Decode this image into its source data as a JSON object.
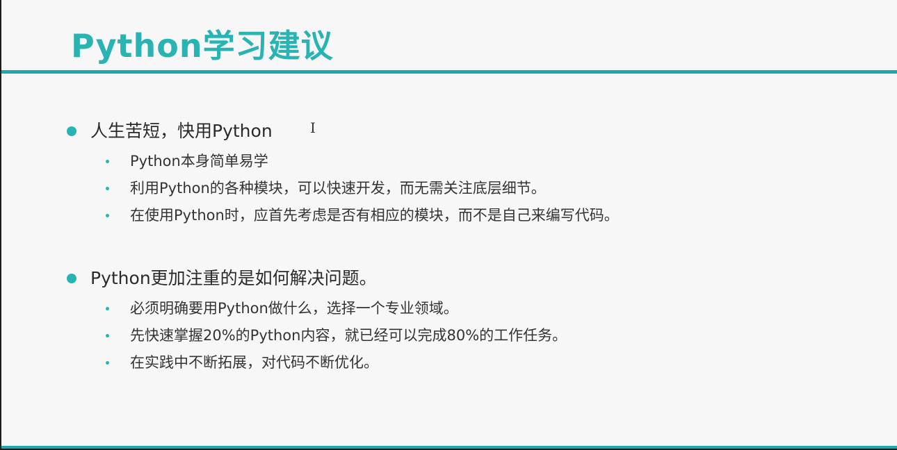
{
  "slide": {
    "title": "Python学习建议",
    "accent_color": "#2ab3b3",
    "rule_color": "#1fa8ac",
    "sections": [
      {
        "heading": "人生苦短，快用Python",
        "items": [
          "Python本身简单易学",
          "利用Python的各种模块，可以快速开发，而无需关注底层细节。",
          "在使用Python时，应首先考虑是否有相应的模块，而不是自己来编写代码。"
        ]
      },
      {
        "heading": "Python更加注重的是如何解决问题。",
        "items": [
          "必须明确要用Python做什么，选择一个专业领域。",
          "先快速掌握20%的Python内容，就已经可以完成80%的工作任务。",
          "在实践中不断拓展，对代码不断优化。"
        ]
      }
    ]
  }
}
